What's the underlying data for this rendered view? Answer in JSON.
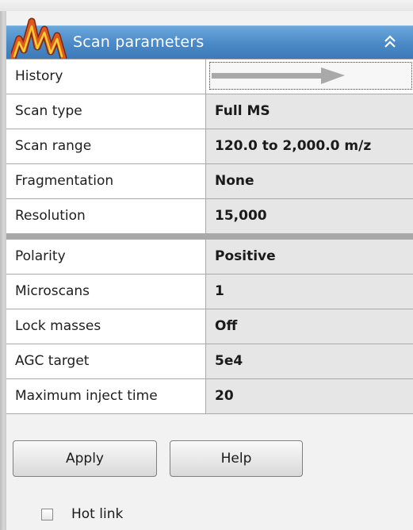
{
  "header": {
    "title": "Scan parameters",
    "collapse_icon": "double-chevron-up-icon",
    "logo_icon": "spectrum-peaks-logo",
    "colors": {
      "header_bg": "#4a88c6",
      "logo_peaks": [
        "#f2b320",
        "#d83a1d",
        "#f4d23a"
      ]
    }
  },
  "rows": [
    {
      "label": "History",
      "value": "",
      "value_icon": "arrow-right-icon"
    },
    {
      "label": "Scan type",
      "value": "Full MS"
    },
    {
      "label": "Scan range",
      "value": "120.0 to 2,000.0 m/z"
    },
    {
      "label": "Fragmentation",
      "value": "None"
    },
    {
      "label": "Resolution",
      "value": "15,000"
    },
    {
      "label": "Polarity",
      "value": "Positive"
    },
    {
      "label": "Microscans",
      "value": "1"
    },
    {
      "label": "Lock masses",
      "value": "Off"
    },
    {
      "label": "AGC target",
      "value": "5e4"
    },
    {
      "label": "Maximum inject time",
      "value": "20"
    }
  ],
  "buttons": {
    "apply_label": "Apply",
    "help_label": "Help"
  },
  "hotlink": {
    "label": "Hot link",
    "checked": false
  }
}
